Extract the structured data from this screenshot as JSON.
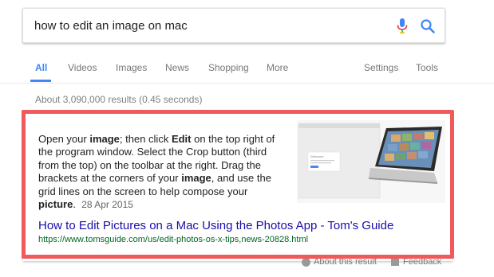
{
  "search": {
    "query": "how to edit an image on mac"
  },
  "tabs": {
    "items": [
      "All",
      "Videos",
      "Images",
      "News",
      "Shopping",
      "More"
    ],
    "right": [
      "Settings",
      "Tools"
    ]
  },
  "result_stats": "About 3,090,000 results (0.45 seconds)",
  "featured_snippet": {
    "text_parts": [
      "Open your ",
      "image",
      "; then click ",
      "Edit",
      " on the top right of the program window. Select the Crop button (third from the top) on the toolbar at the right. Drag the brackets at the corners of your ",
      "image",
      ", and use the grid lines on the screen to help compose your ",
      "picture",
      "."
    ],
    "date": "28 Apr 2015",
    "thumbnail_caption": "Welcome",
    "title": "How to Edit Pictures on a Mac Using the Photos App - Tom's Guide",
    "url": "https://www.tomsguide.com/us/edit-photos-os-x-tips,news-20828.html"
  },
  "footer": {
    "about": "About this result",
    "feedback": "Feedback"
  },
  "colors": {
    "highlight_border": "#f05a5a",
    "link": "#1a0dab",
    "url": "#006621",
    "accent": "#4285f4"
  }
}
